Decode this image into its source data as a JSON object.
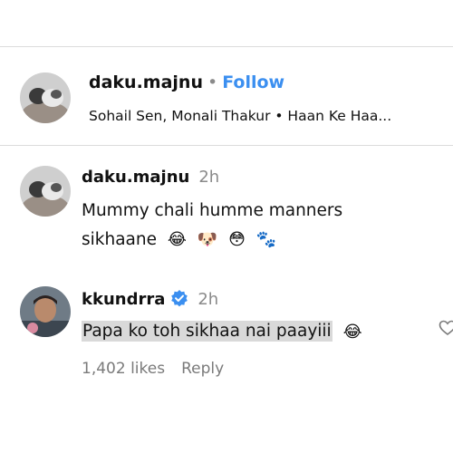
{
  "post_header": {
    "username": "daku.majnu",
    "separator": "•",
    "follow_label": "Follow",
    "audio": "Sohail Sen, Monali Thakur • Haan Ke Haa..."
  },
  "comments": [
    {
      "username": "daku.majnu",
      "time": "2h",
      "text": "Mummy chali humme manners sikhaane",
      "emojis": [
        "😂",
        "🐶",
        "😳",
        "🐾"
      ]
    },
    {
      "username": "kkundrra",
      "verified": true,
      "time": "2h",
      "text": "Papa ko toh sikhaa nai paayiii",
      "emoji": "😂",
      "likes": "1,402 likes",
      "reply_label": "Reply"
    }
  ],
  "icons": {
    "verified": "verified-badge-icon",
    "like": "heart-outline-icon"
  },
  "colors": {
    "follow": "#3b8ff0",
    "verified": "#3b8ff0",
    "highlight": "#d9d9d9"
  }
}
